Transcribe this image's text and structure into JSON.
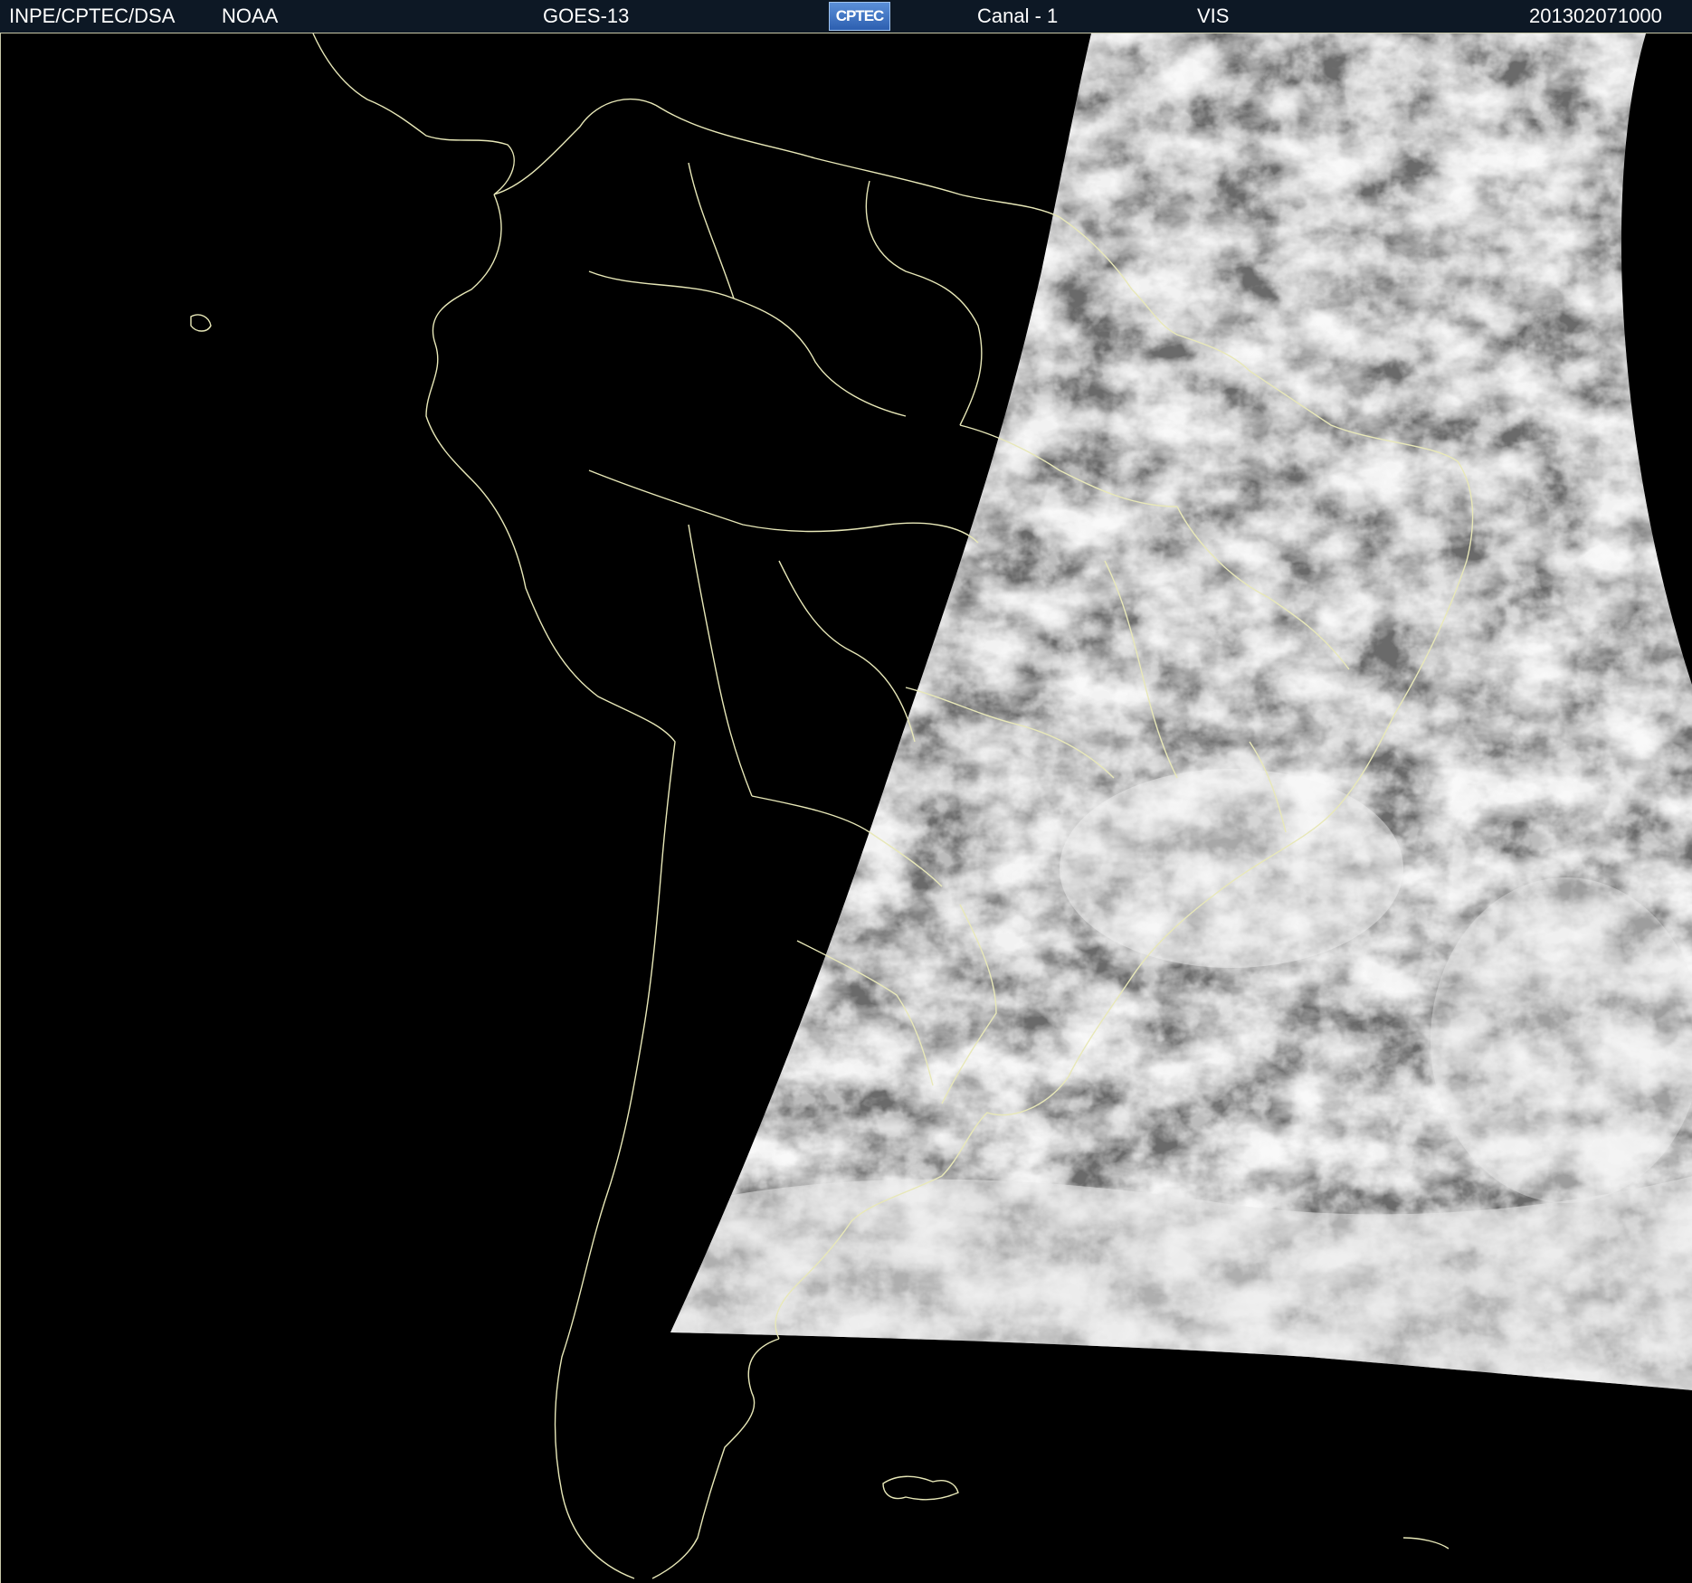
{
  "header": {
    "agency": "INPE/CPTEC/DSA",
    "source": "NOAA",
    "satellite": "GOES-13",
    "logo_text": "CPTEC",
    "channel": "Canal - 1",
    "band": "VIS",
    "timestamp": "201302071000"
  },
  "colors": {
    "header_background": "#0d1825",
    "border_lines": "#e8e8b8",
    "space_background": "#000000",
    "cloud_white": "#f2f2f2",
    "ocean_gray": "#6a6a6a"
  },
  "map": {
    "type": "satellite-visible-image",
    "region": "South America",
    "overlay": "political-boundaries"
  }
}
